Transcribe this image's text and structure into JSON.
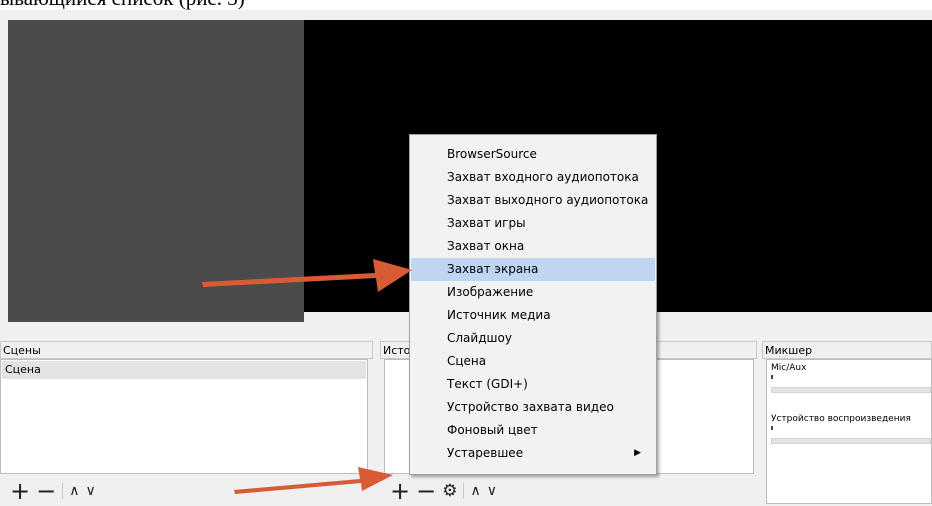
{
  "caption": "ывающийся список (рис. 3)",
  "docks": {
    "scenes": {
      "title": "Сцены",
      "items": [
        "Сцена"
      ]
    },
    "sources": {
      "title": "Исто"
    },
    "mixer": {
      "title": "Микшер",
      "channels": [
        {
          "label": "Mic/Aux"
        },
        {
          "label": "Устройство воспроизведения"
        }
      ]
    }
  },
  "controls": {
    "add": "+",
    "remove": "−",
    "up": "∧",
    "down": "∨",
    "gear": "⚙"
  },
  "menu": {
    "items": [
      "BrowserSource",
      "Захват входного аудиопотока",
      "Захват выходного аудиопотока",
      "Захват игры",
      "Захват окна",
      "Захват экрана",
      "Изображение",
      "Источник медиа",
      "Слайдшоу",
      "Сцена",
      "Текст (GDI+)",
      "Устройство захвата видео",
      "Фоновый цвет",
      "Устаревшее"
    ],
    "highlighted_item": "Захват экрана",
    "submenu_arrow": "▶"
  },
  "colors": {
    "arrow": "#d95b36",
    "highlight": "#bfd6f3",
    "preview_gray": "#4a4a4a",
    "preview_black": "#000000"
  }
}
